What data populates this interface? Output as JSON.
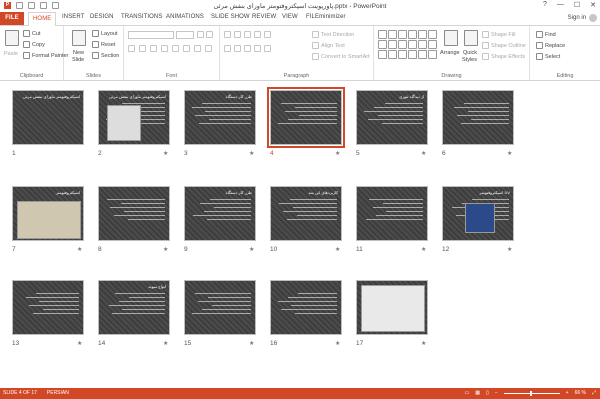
{
  "window": {
    "title": "پاورپوینت اسپکتروفتومتر ماورای بنفش مرئی.pptx - PowerPoint",
    "controls": [
      "?",
      "—",
      "☐",
      "✕"
    ]
  },
  "tabs": [
    {
      "label": "FILE"
    },
    {
      "label": "HOME"
    },
    {
      "label": "INSERT"
    },
    {
      "label": "DESIGN"
    },
    {
      "label": "TRANSITIONS"
    },
    {
      "label": "ANIMATIONS"
    },
    {
      "label": "SLIDE SHOW"
    },
    {
      "label": "REVIEW"
    },
    {
      "label": "VIEW"
    },
    {
      "label": "FILEminimizer"
    }
  ],
  "account": {
    "sign_in": "Sign in"
  },
  "ribbon": {
    "clipboard": {
      "label": "Clipboard",
      "paste": "Paste",
      "cut": "Cut",
      "copy": "Copy",
      "format_painter": "Format Painter"
    },
    "slides": {
      "label": "Slides",
      "new_slide": "New",
      "new_slide2": "Slide",
      "layout": "Layout",
      "reset": "Reset",
      "section": "Section"
    },
    "font": {
      "label": "Font"
    },
    "paragraph": {
      "label": "Paragraph",
      "text_direction": "Text Direction",
      "align_text": "Align Text",
      "convert": "Convert to SmartArt"
    },
    "drawing": {
      "label": "Drawing",
      "arrange": "Arrange",
      "quick_styles": "Quick",
      "quick_styles2": "Styles",
      "shape_fill": "Shape Fill",
      "shape_outline": "Shape Outline",
      "shape_effects": "Shape Effects"
    },
    "editing": {
      "label": "Editing",
      "find": "Find",
      "replace": "Replace",
      "select": "Select"
    }
  },
  "slides": [
    {
      "num": "1",
      "title": "اسپکتروفتومتر ماورای بنفش مرئی",
      "star": ""
    },
    {
      "num": "2",
      "title": "اسپکتروفتومتر ماورای بنفش مرئی",
      "star": "★"
    },
    {
      "num": "3",
      "title": "طرز کار دستگاه",
      "star": "★"
    },
    {
      "num": "4",
      "title": "",
      "star": "★"
    },
    {
      "num": "5",
      "title": "از دیدگاه تئوری",
      "star": "★"
    },
    {
      "num": "6",
      "title": "",
      "star": "★"
    },
    {
      "num": "7",
      "title": "اسپکتروفتومتر",
      "star": "★"
    },
    {
      "num": "8",
      "title": "",
      "star": "★"
    },
    {
      "num": "9",
      "title": "طرز کار دستگاه",
      "star": "★"
    },
    {
      "num": "10",
      "title": "کاربردهای این متد",
      "star": "★"
    },
    {
      "num": "11",
      "title": "",
      "star": "★"
    },
    {
      "num": "12",
      "title": "اسپکتروفتومتر UV",
      "star": "★"
    },
    {
      "num": "13",
      "title": "",
      "star": "★"
    },
    {
      "num": "14",
      "title": "انواع نمونه",
      "star": "★"
    },
    {
      "num": "15",
      "title": "",
      "star": "★"
    },
    {
      "num": "16",
      "title": "",
      "star": "★"
    },
    {
      "num": "17",
      "title": "",
      "star": "★"
    }
  ],
  "status": {
    "slide_info": "SLIDE 4 OF 17",
    "language": "PERSIAN",
    "zoom": "66 %"
  },
  "colors": {
    "accent": "#d24726"
  }
}
